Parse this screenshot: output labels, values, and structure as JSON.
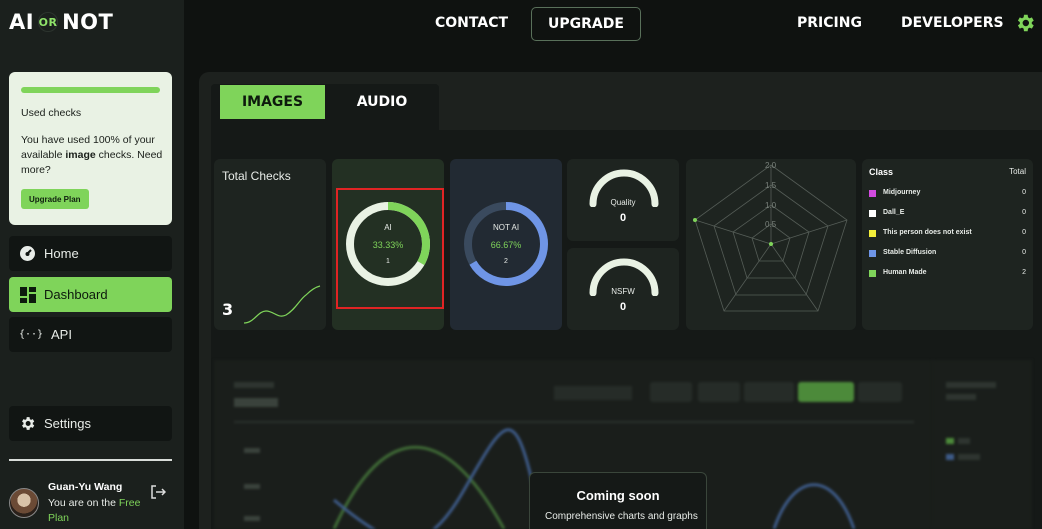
{
  "brand": {
    "left": "AI",
    "mid": "OR",
    "right": "NOT"
  },
  "topnav": {
    "contact": "CONTACT",
    "upgrade": "UPGRADE",
    "pricing": "PRICING",
    "developers": "DEVELOPERS"
  },
  "usage": {
    "title": "Used checks",
    "desc_prefix": "You have used 100% of your available ",
    "desc_bold": "image",
    "desc_suffix": " checks. Need more?",
    "percent": 100,
    "button": "Upgrade Plan"
  },
  "sidebar": {
    "items": [
      {
        "label": "Home",
        "icon": "gauge-icon"
      },
      {
        "label": "Dashboard",
        "icon": "dashboard-icon"
      },
      {
        "label": "API",
        "icon": "braces-icon",
        "glyph": "{··}"
      }
    ],
    "settings": "Settings"
  },
  "user": {
    "name": "Guan-Yu Wang",
    "plan_prefix": "You are on the ",
    "plan_name": "Free Plan"
  },
  "tabs": {
    "images": "IMAGES",
    "audio": "AUDIO"
  },
  "total_checks": {
    "label": "Total Checks",
    "value": "3"
  },
  "ai_card": {
    "label": "AI",
    "percent": "33.33%",
    "count": "1",
    "fraction": 0.3333,
    "color": "#7fd45a"
  },
  "notai_card": {
    "label": "NOT AI",
    "percent": "66.67%",
    "count": "2",
    "fraction": 0.6667,
    "color": "#6f95e6"
  },
  "quality": {
    "label": "Quality",
    "value": "0"
  },
  "nsfw": {
    "label": "NSFW",
    "value": "0"
  },
  "radar": {
    "ticks": [
      "2.0",
      "1.5",
      "1.0",
      "0.5"
    ]
  },
  "classes": {
    "header": "Class",
    "total_header": "Total",
    "rows": [
      {
        "label": "Midjourney",
        "count": "0",
        "color": "#d24be0"
      },
      {
        "label": "Dall_E",
        "count": "0",
        "color": "#ffffff"
      },
      {
        "label": "This person does not exist",
        "count": "0",
        "color": "#f2ee3a"
      },
      {
        "label": "Stable Diffusion",
        "count": "0",
        "color": "#6f95e6"
      },
      {
        "label": "Human Made",
        "count": "2",
        "color": "#7fd45a"
      }
    ]
  },
  "coming_soon": {
    "title": "Coming soon",
    "subtitle": "Comprehensive charts and graphs"
  }
}
